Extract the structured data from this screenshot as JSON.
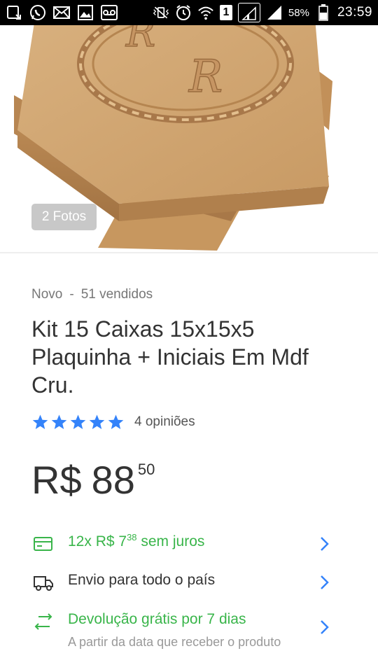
{
  "status_bar": {
    "sim_slot": "1",
    "battery_percent": "58%",
    "time": "23:59"
  },
  "gallery": {
    "photos_label": "2 Fotos",
    "image_monogram": "R"
  },
  "product": {
    "condition": "Novo",
    "separator": "-",
    "sold": "51 vendidos",
    "title": "Kit 15 Caixas 15x15x5 Plaquinha + Iniciais Em Mdf Cru.",
    "rating_stars": 5,
    "reviews": "4 opiniões",
    "price": {
      "currency": "R$",
      "integer": "88",
      "cents": "50"
    }
  },
  "installments": {
    "prefix": "12x R$ 7",
    "cents": "38",
    "suffix": "sem juros"
  },
  "shipping": {
    "label": "Envio para todo o país"
  },
  "returns": {
    "label": "Devolução grátis por 7 dias",
    "subtext": "A partir da data que receber o produto"
  },
  "colors": {
    "accent_green": "#39b54a",
    "link_blue": "#3483fa",
    "star_blue": "#3483fa",
    "text_dark": "#333333",
    "text_gray": "#999999"
  }
}
